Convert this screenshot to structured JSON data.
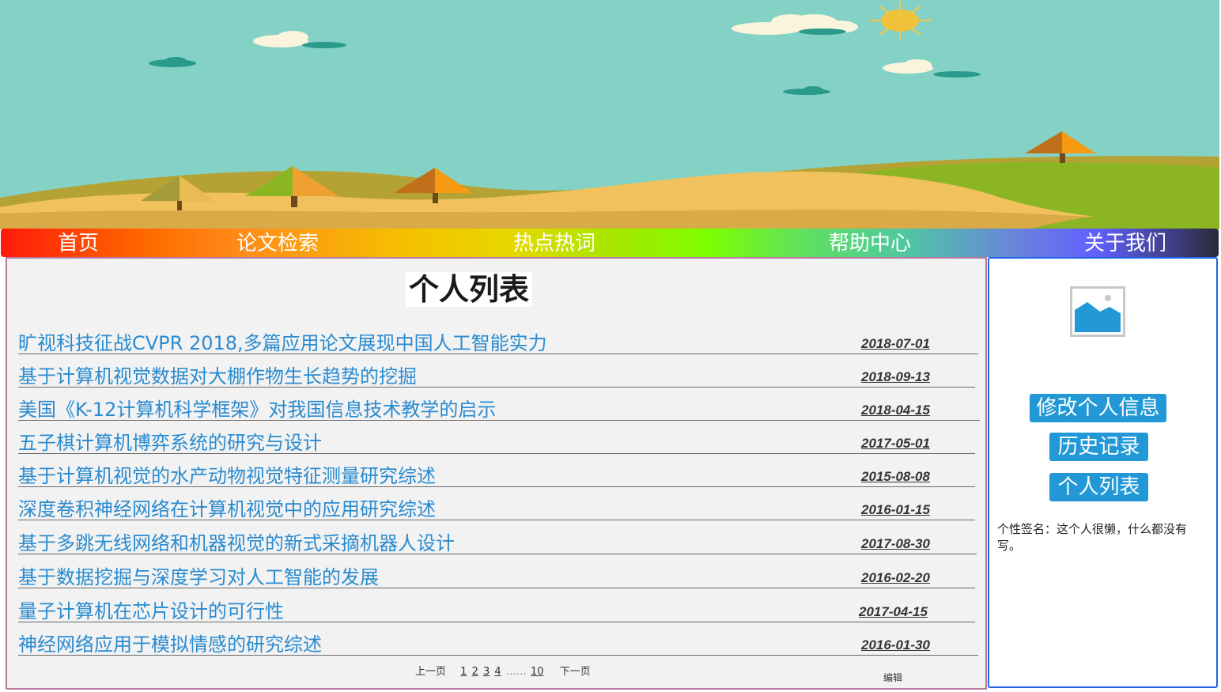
{
  "nav": {
    "items": [
      {
        "label": "首页"
      },
      {
        "label": "论文检索"
      },
      {
        "label": "热点热词"
      },
      {
        "label": "帮助中心"
      },
      {
        "label": "关于我们"
      }
    ]
  },
  "main": {
    "title": "个人列表",
    "rows": [
      {
        "title": "旷视科技征战CVPR 2018,多篇应用论文展现中国人工智能实力",
        "date": "2018-07-01"
      },
      {
        "title": "基于计算机视觉数据对大棚作物生长趋势的挖掘",
        "date": "2018-09-13"
      },
      {
        "title": "美国《K-12计算机科学框架》对我国信息技术教学的启示",
        "date": "2018-04-15"
      },
      {
        "title": "五子棋计算机博弈系统的研究与设计",
        "date": "2017-05-01"
      },
      {
        "title": "基于计算机视觉的水产动物视觉特征测量研究综述",
        "date": "2015-08-08"
      },
      {
        "title": "深度卷积神经网络在计算机视觉中的应用研究综述",
        "date": "2016-01-15"
      },
      {
        "title": "基于多跳无线网络和机器视觉的新式采摘机器人设计",
        "date": "2017-08-30"
      },
      {
        "title": "基于数据挖掘与深度学习对人工智能的发展",
        "date": "2016-02-20"
      },
      {
        "title": "量子计算机在芯片设计的可行性",
        "date": "2017-04-15"
      },
      {
        "title": "神经网络应用于模拟情感的研究综述",
        "date": "2016-01-30"
      }
    ],
    "pager": {
      "prev": "上一页",
      "pages": [
        "1",
        "2",
        "3",
        "4"
      ],
      "ellipsis": "……",
      "last": "10",
      "next": "下一页"
    },
    "edit": "编辑"
  },
  "side": {
    "buttons": [
      {
        "label": "修改个人信息"
      },
      {
        "label": "历史记录"
      },
      {
        "label": "个人列表"
      }
    ],
    "signature": "个性签名：这个人很懒，什么都没有写。"
  },
  "colors": {
    "link": "#2a8bd0",
    "button": "#2299d6",
    "main_border": "#b77ba1",
    "side_border": "#1e63e8"
  }
}
